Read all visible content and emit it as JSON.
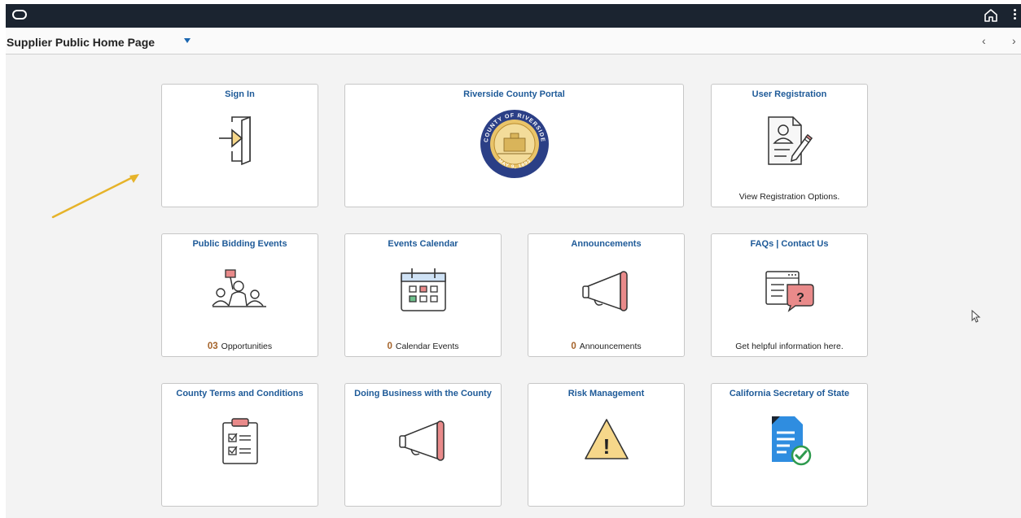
{
  "header": {
    "title": "Supplier Public Home Page"
  },
  "tiles": [
    {
      "title": "Sign In",
      "icon": "sign-in-door-icon"
    },
    {
      "title": "Riverside County Portal",
      "icon": "county-seal-icon",
      "seal_top_text": "COUNTY OF RIVERSIDE",
      "seal_bottom_text": "MAY 9, 1893"
    },
    {
      "title": "User Registration",
      "icon": "user-registration-icon",
      "footer": "View Registration Options."
    },
    {
      "title": "Public Bidding Events",
      "icon": "auction-bidder-icon",
      "count": "03",
      "footer": "Opportunities"
    },
    {
      "title": "Events Calendar",
      "icon": "calendar-icon",
      "count": "0",
      "footer": "Calendar Events"
    },
    {
      "title": "Announcements",
      "icon": "megaphone-icon",
      "count": "0",
      "footer": "Announcements"
    },
    {
      "title": "FAQs | Contact Us",
      "icon": "faq-question-icon",
      "footer": "Get helpful information here."
    },
    {
      "title": "County Terms and Conditions",
      "icon": "checklist-clipboard-icon"
    },
    {
      "title": "Doing Business with the County",
      "icon": "megaphone-icon"
    },
    {
      "title": "Risk Management",
      "icon": "warning-triangle-icon",
      "warning_mark": "!"
    },
    {
      "title": "California Secretary of State",
      "icon": "document-check-icon"
    }
  ],
  "colors": {
    "topbar": "#1b2430",
    "tile_title": "#1e5a98",
    "count": "#a5632a",
    "annotation_arrow": "#e6b32a",
    "accent_pink": "#e98a8a",
    "accent_blue": "#2f8de0",
    "accent_green": "#2e9a4e"
  }
}
